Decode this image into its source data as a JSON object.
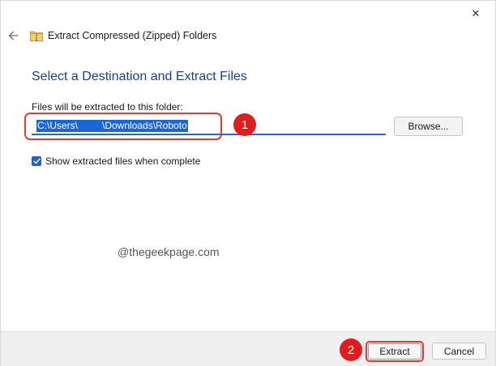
{
  "window": {
    "title": "Extract Compressed (Zipped) Folders",
    "close_glyph": "✕",
    "back_icon": "arrow-left-icon",
    "folder_icon": "zipped-folder-icon"
  },
  "main": {
    "heading": "Select a Destination and Extract Files",
    "destination_label": "Files will be extracted to this folder:",
    "destination_path": "C:\\Users\\         \\Downloads\\Roboto",
    "browse_label": "Browse...",
    "show_files_label": "Show extracted files when complete",
    "show_files_checked": true
  },
  "annotations": {
    "badge_1": "1",
    "badge_2": "2",
    "highlight_color": "#e53935",
    "badge_color": "#e01c1c"
  },
  "watermark": "@thegeekpage.com",
  "footer": {
    "extract_label": "Extract",
    "cancel_label": "Cancel"
  },
  "colors": {
    "heading": "#1c3f94",
    "accent": "#1f63c6",
    "selection": "#1a66d6"
  }
}
